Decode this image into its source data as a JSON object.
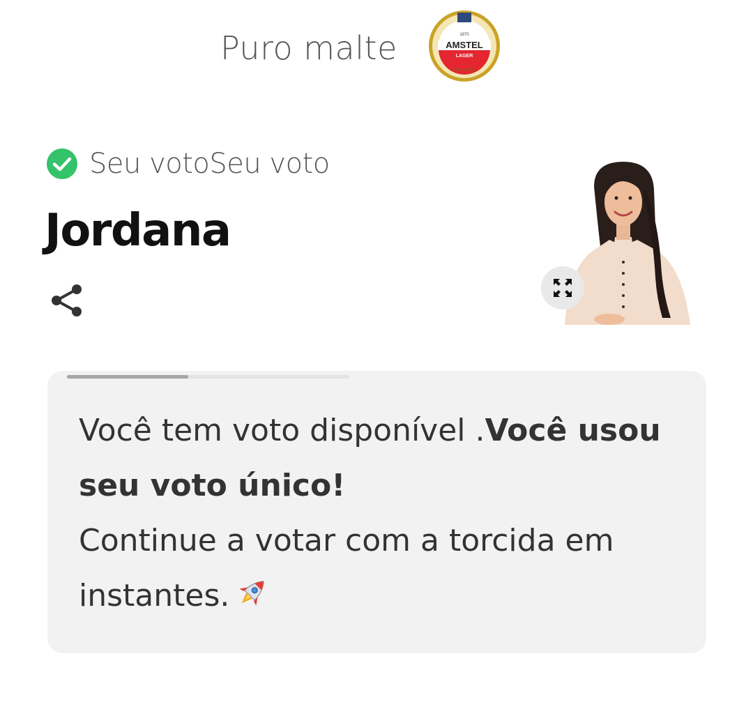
{
  "sponsor": {
    "text": "Puro malte",
    "logo": {
      "year": "1870",
      "brand": "AMSTEL",
      "type": "LAGER",
      "arc_text": "AMSTERDAM"
    }
  },
  "vote": {
    "status_label": "Seu votoSeu voto",
    "candidate_name": "Jordana",
    "icons": {
      "check": "check-circle-icon",
      "share": "share-icon",
      "expand": "expand-icon"
    }
  },
  "message": {
    "line_start": "Você tem voto disponível .",
    "bold_part": "Você usou seu voto único!",
    "line_continue": "Continue a votar com a torcida em instantes.",
    "emoji": "🚀",
    "progress": 0.43
  },
  "colors": {
    "check_green": "#34c26a",
    "card_bg": "#f2f2f2",
    "logo_red": "#e3262f",
    "logo_gold": "#c9a227"
  }
}
